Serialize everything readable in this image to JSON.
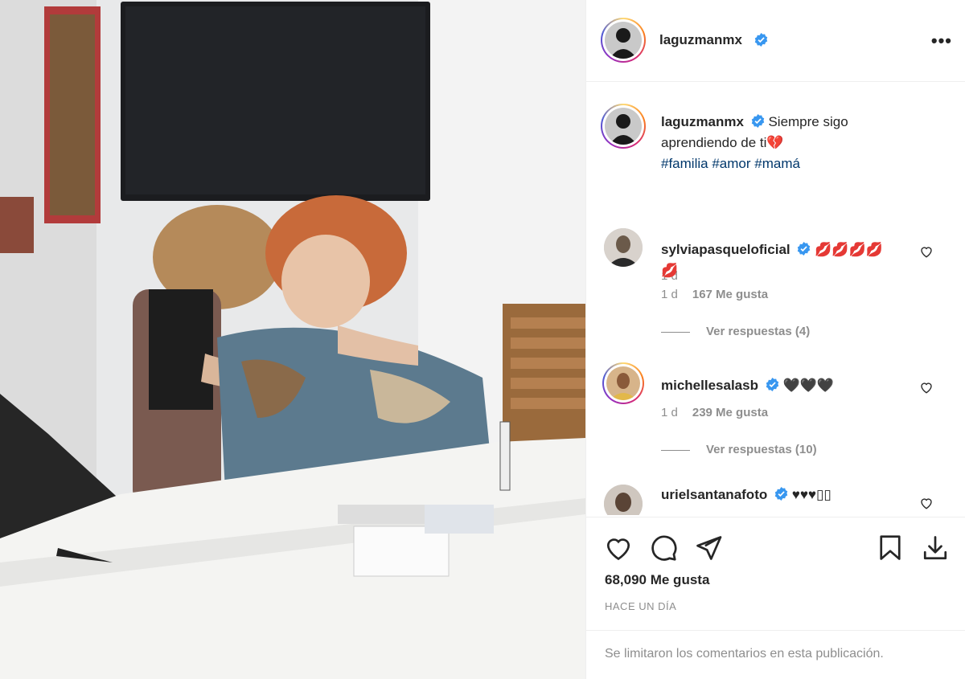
{
  "post": {
    "username": "laguzmanmx",
    "caption": "Siempre sigo aprendiendo de ti💔",
    "hashtags": [
      "#familia",
      "#amor",
      "#mamá"
    ],
    "time_ago": "1 d"
  },
  "comments": [
    {
      "username": "sylviapasqueloficial",
      "text": "💋💋💋💋 💋",
      "time": "1 d",
      "likes": "167 Me gusta",
      "replies": "Ver respuestas (4)"
    },
    {
      "username": "michellesalasb",
      "text": "🖤🖤🖤",
      "time": "1 d",
      "likes": "239 Me gusta",
      "replies": "Ver respuestas (10)"
    },
    {
      "username": "urielsantanafoto",
      "text": "♥♥♥▯▯"
    }
  ],
  "footer": {
    "likes": "68,090 Me gusta",
    "posted": "HACE UN DÍA",
    "comments_limited": "Se limitaron los comentarios en esta publicación."
  },
  "icons": {
    "more": "more-options-icon",
    "verified": "verified-badge-icon",
    "like": "heart-icon",
    "comment": "comment-icon",
    "share": "share-icon",
    "save": "bookmark-icon",
    "download": "download-icon"
  },
  "colors": {
    "verified": "#3897f0",
    "hashtag": "#00376b",
    "meta": "#8e8e8e",
    "text": "#262626"
  }
}
